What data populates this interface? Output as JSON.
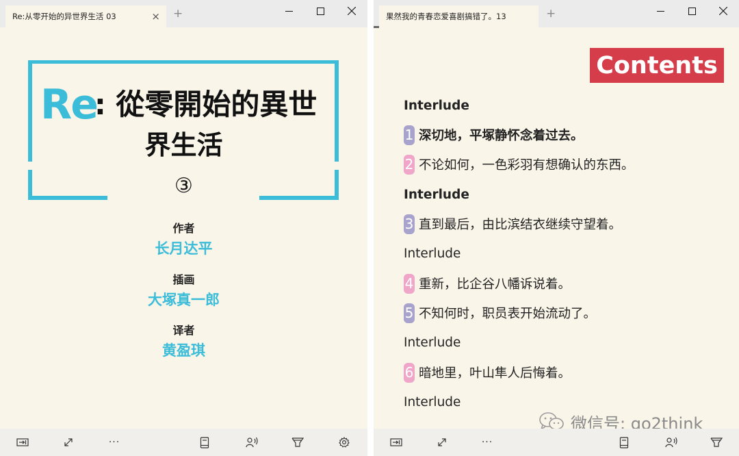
{
  "colors": {
    "accent_cyan": "#3bbcd8",
    "contents_red": "#d63d4b",
    "page_bg": "#faf5e9",
    "num_purple": "#a8a3cc",
    "num_pink": "#efa6c8"
  },
  "left_window": {
    "tab_title": "Re:从零开始的异世界生活 03",
    "tab_close": "×",
    "new_tab": "+",
    "cover": {
      "re": "Re",
      "title_line1": ": 從零開始的異世",
      "title_line2": "界生活",
      "volume": "③",
      "author_label": "作者",
      "author_name": "长月达平",
      "illustrator_label": "插画",
      "illustrator_name": "大塚真一郎",
      "translator_label": "译者",
      "translator_name": "黄盈琪"
    },
    "bottom_more": "···"
  },
  "right_window": {
    "tab_title": "果然我的青春恋爱喜剧搞错了。13",
    "tab_close": "×",
    "new_tab": "+",
    "contents_title": "Contents",
    "toc": [
      {
        "num": "",
        "title": "Interlude",
        "bold": true
      },
      {
        "num": "1",
        "title": "深切地，平塚静怀念着过去。",
        "bold": true,
        "num_color": "#a8a3cc"
      },
      {
        "num": "2",
        "title": "不论如何，一色彩羽有想确认的东西。",
        "bold": false,
        "num_color": "#efa6c8"
      },
      {
        "num": "",
        "title": "Interlude",
        "bold": true
      },
      {
        "num": "3",
        "title": "直到最后，由比滨结衣继续守望着。",
        "bold": false,
        "num_color": "#a8a3cc"
      },
      {
        "num": "",
        "title": "Interlude",
        "bold": false
      },
      {
        "num": "4",
        "title": "重新，比企谷八幡诉说着。",
        "bold": false,
        "num_color": "#efa6c8"
      },
      {
        "num": "5",
        "title": "不知何时，职员表开始流动了。",
        "bold": false,
        "num_color": "#a8a3cc"
      },
      {
        "num": "",
        "title": "Interlude",
        "bold": false
      },
      {
        "num": "6",
        "title": "暗地里，叶山隼人后悔着。",
        "bold": false,
        "num_color": "#efa6c8"
      },
      {
        "num": "",
        "title": "Interlude",
        "bold": false
      }
    ],
    "bottom_more": "···",
    "watermark": "微信号: go2think"
  }
}
